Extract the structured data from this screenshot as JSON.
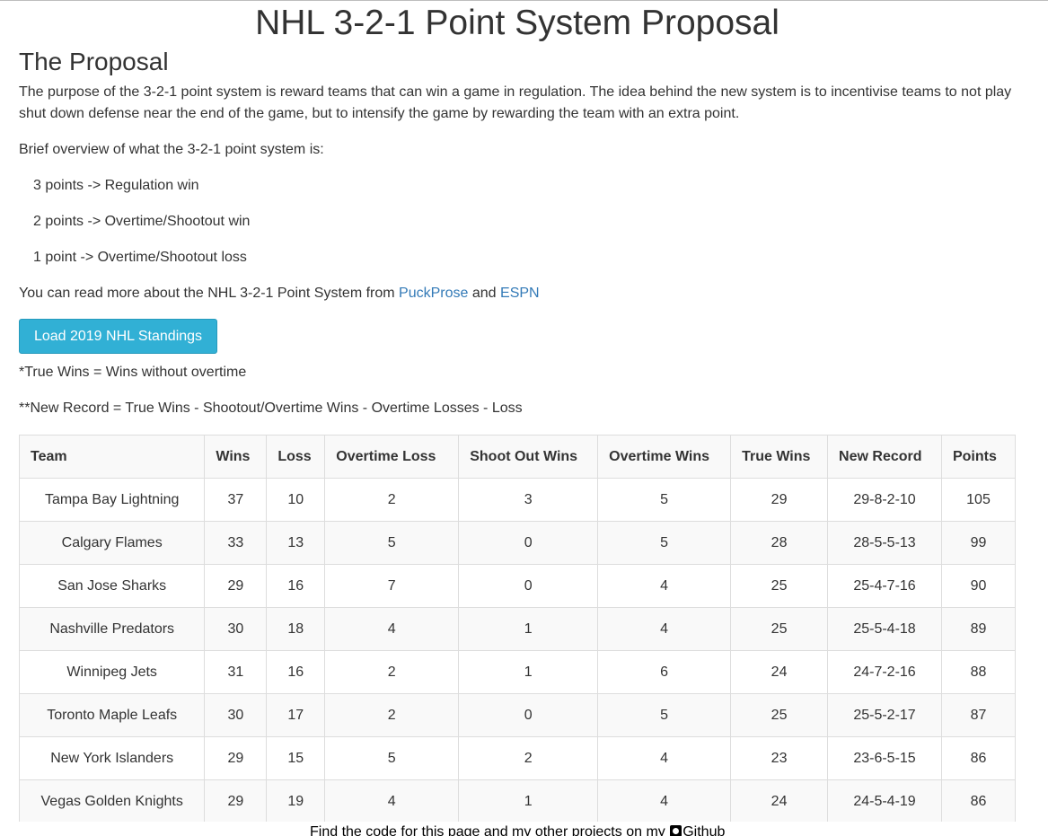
{
  "title": "NHL 3-2-1 Point System Proposal",
  "proposal": {
    "heading": "The Proposal",
    "intro": "The purpose of the 3-2-1 point system is reward teams that can win a game in regulation. The idea behind the new system is to incentivise teams to not play shut down defense near the end of the game, but to intensify the game by rewarding the team with an extra point.",
    "overview": "Brief overview of what the 3-2-1 point system is:",
    "points": [
      "3 points -> Regulation win",
      "2 points -> Overtime/Shootout win",
      "1 point -> Overtime/Shootout loss"
    ],
    "read_more_prefix": "You can read more about the NHL 3-2-1 Point System from",
    "read_more_and": "and",
    "link_puckprose": "PuckProse",
    "link_espn": "ESPN"
  },
  "load_button": "Load 2019 NHL Standings",
  "notes": {
    "true_wins": "*True Wins = Wins without overtime",
    "new_record": "**New Record = True Wins - Shootout/Overtime Wins - Overtime Losses - Loss"
  },
  "table": {
    "headers": [
      "Team",
      "Wins",
      "Loss",
      "Overtime Loss",
      "Shoot Out Wins",
      "Overtime Wins",
      "True Wins",
      "New Record",
      "Points"
    ],
    "rows": [
      [
        "Tampa Bay Lightning",
        "37",
        "10",
        "2",
        "3",
        "5",
        "29",
        "29-8-2-10",
        "105"
      ],
      [
        "Calgary Flames",
        "33",
        "13",
        "5",
        "0",
        "5",
        "28",
        "28-5-5-13",
        "99"
      ],
      [
        "San Jose Sharks",
        "29",
        "16",
        "7",
        "0",
        "4",
        "25",
        "25-4-7-16",
        "90"
      ],
      [
        "Nashville Predators",
        "30",
        "18",
        "4",
        "1",
        "4",
        "25",
        "25-5-4-18",
        "89"
      ],
      [
        "Winnipeg Jets",
        "31",
        "16",
        "2",
        "1",
        "6",
        "24",
        "24-7-2-16",
        "88"
      ],
      [
        "Toronto Maple Leafs",
        "30",
        "17",
        "2",
        "0",
        "5",
        "25",
        "25-5-2-17",
        "87"
      ],
      [
        "New York Islanders",
        "29",
        "15",
        "5",
        "2",
        "4",
        "23",
        "23-6-5-15",
        "86"
      ],
      [
        "Vegas Golden Knights",
        "29",
        "19",
        "4",
        "1",
        "4",
        "24",
        "24-5-4-19",
        "86"
      ]
    ]
  },
  "footer": {
    "text": "Find the code for this page and my other projects on my",
    "link": "Github",
    "icon": "github-icon"
  }
}
